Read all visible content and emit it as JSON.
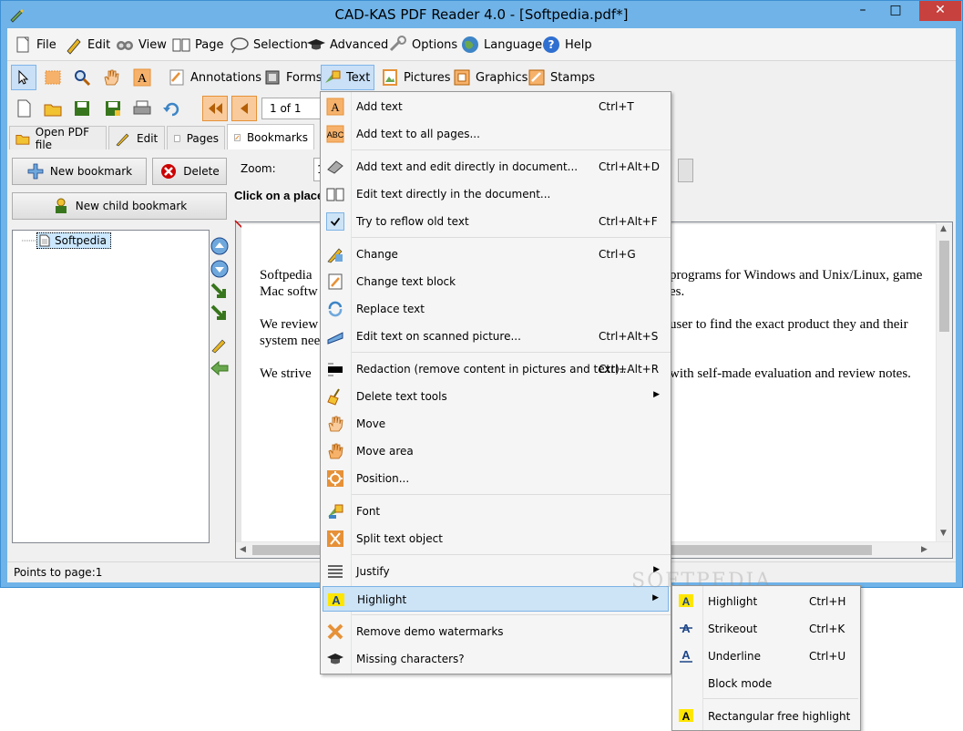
{
  "window": {
    "title": "CAD-KAS PDF Reader 4.0 - [Softpedia.pdf*]",
    "minimize": "–",
    "maximize": "□",
    "close": "✕"
  },
  "menubar": [
    {
      "label": "File",
      "icon": "file-icon"
    },
    {
      "label": "Edit",
      "icon": "edit-icon"
    },
    {
      "label": "View",
      "icon": "view-icon"
    },
    {
      "label": "Page",
      "icon": "page-icon"
    },
    {
      "label": "Selection",
      "icon": "selection-icon"
    },
    {
      "label": "Advanced",
      "icon": "advanced-icon"
    },
    {
      "label": "Options",
      "icon": "options-icon"
    },
    {
      "label": "Language",
      "icon": "language-icon"
    },
    {
      "label": "Help",
      "icon": "help-icon"
    }
  ],
  "toolbar1": {
    "annotations": "Annotations",
    "forms": "Forms",
    "text": "Text",
    "pictures": "Pictures",
    "graphics": "Graphics",
    "stamps": "Stamps"
  },
  "toolbar2": {
    "page_counter": "1 of 1"
  },
  "tabs": [
    {
      "label": "Open PDF file"
    },
    {
      "label": "Edit"
    },
    {
      "label": "Pages"
    },
    {
      "label": "Bookmarks"
    }
  ],
  "bookmarks": {
    "new_bookmark": "New bookmark",
    "delete": "Delete",
    "new_child": "New child bookmark",
    "tree_item": "Softpedia"
  },
  "editor": {
    "zoom_label": "Zoom:",
    "zoom_value": "1",
    "hint": "Click on a place",
    "lines": [
      "Softpedia",
      "Mac softw",
      "We review",
      "system nee",
      "We strive"
    ],
    "lines_right": [
      "programs for Windows and Unix/Linux, game",
      "es.",
      "user to find the exact product they and their",
      "",
      "with self-made evaluation and review notes."
    ]
  },
  "status": {
    "text": "Points to page:1"
  },
  "text_menu": [
    {
      "label": "Add text",
      "shortcut": "Ctrl+T",
      "icon": "add-text-icon"
    },
    {
      "label": "Add text to all pages...",
      "shortcut": "",
      "icon": "add-text-all-icon"
    },
    {
      "label": "Add text and edit directly in document...",
      "shortcut": "Ctrl+Alt+D",
      "icon": "eraser-icon"
    },
    {
      "label": "Edit text directly in the document...",
      "shortcut": "",
      "icon": "book-icon"
    },
    {
      "label": "Try to reflow old text",
      "shortcut": "Ctrl+Alt+F",
      "icon": "check-icon"
    },
    {
      "label": "Change",
      "shortcut": "Ctrl+G",
      "icon": "pen-icon"
    },
    {
      "label": "Change text block",
      "shortcut": "",
      "icon": "notepad-icon"
    },
    {
      "label": "Replace text",
      "shortcut": "",
      "icon": "replace-icon"
    },
    {
      "label": "Edit text on scanned picture...",
      "shortcut": "Ctrl+Alt+S",
      "icon": "scanner-icon"
    },
    {
      "label": "Redaction (remove content in pictures and text)...",
      "shortcut": "Ctrl+Alt+R",
      "icon": "redaction-icon"
    },
    {
      "label": "Delete text tools",
      "shortcut": "",
      "icon": "broom-icon"
    },
    {
      "label": "Move",
      "shortcut": "",
      "icon": "hand-icon"
    },
    {
      "label": "Move area",
      "shortcut": "",
      "icon": "hand-area-icon"
    },
    {
      "label": "Position...",
      "shortcut": "",
      "icon": "position-icon"
    },
    {
      "label": "Font",
      "shortcut": "",
      "icon": "font-icon"
    },
    {
      "label": "Split text object",
      "shortcut": "",
      "icon": "split-icon"
    },
    {
      "label": "Justify",
      "shortcut": "",
      "icon": "justify-icon"
    },
    {
      "label": "Highlight",
      "shortcut": "",
      "icon": "highlight-icon"
    },
    {
      "label": "Remove demo watermarks",
      "shortcut": "",
      "icon": "remove-x-icon"
    },
    {
      "label": "Missing characters?",
      "shortcut": "",
      "icon": "grad-cap-icon"
    }
  ],
  "highlight_submenu": [
    {
      "label": "Highlight",
      "shortcut": "Ctrl+H",
      "icon": "highlight-a-icon"
    },
    {
      "label": "Strikeout",
      "shortcut": "Ctrl+K",
      "icon": "strikeout-icon"
    },
    {
      "label": "Underline",
      "shortcut": "Ctrl+U",
      "icon": "underline-icon"
    },
    {
      "label": "Block mode",
      "shortcut": "",
      "icon": ""
    },
    {
      "label": "Rectangular free highlight",
      "shortcut": "",
      "icon": "rect-highlight-icon"
    }
  ],
  "watermark": "SOFTPEDIA"
}
